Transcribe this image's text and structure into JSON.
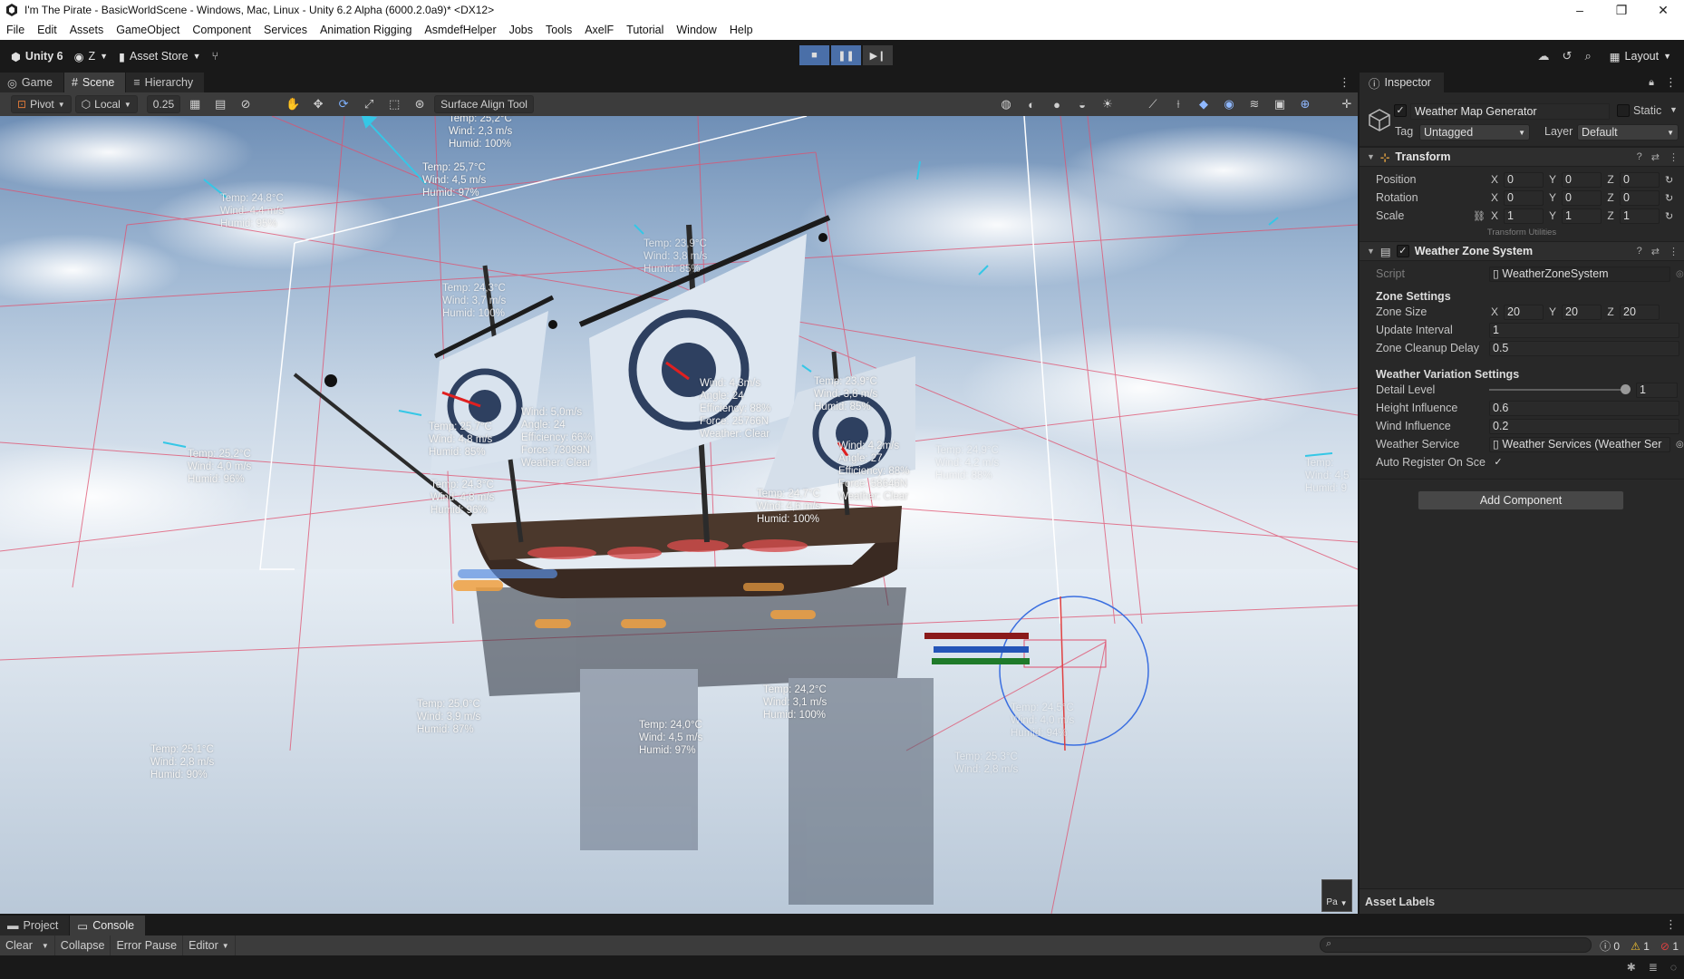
{
  "window": {
    "title": "I'm The Pirate - BasicWorldScene - Windows, Mac, Linux - Unity 6.2 Alpha (6000.2.0a9)* <DX12>",
    "controls": [
      "–",
      "❐",
      "✕"
    ]
  },
  "menu": [
    "File",
    "Edit",
    "Assets",
    "GameObject",
    "Component",
    "Services",
    "Animation Rigging",
    "AsmdefHelper",
    "Jobs",
    "Tools",
    "AxelF",
    "Tutorial",
    "Window",
    "Help"
  ],
  "toolbar": {
    "unity_label": "Unity 6",
    "account_label": "Z",
    "asset_store_label": "Asset Store",
    "layout_label": "Layout"
  },
  "tabs": [
    "Game",
    "Scene",
    "Hierarchy"
  ],
  "scene_toolbar": {
    "pivot_label": "Pivot",
    "local_label": "Local",
    "snap_value": "0.25",
    "surface_align_label": "Surface Align Tool"
  },
  "scene": {
    "weather_labels": [
      "Temp: 25,2°C\nWind: 2,3 m/s\nHumid: 100%",
      "Temp: 25,7°C\nWind: 4,5 m/s\nHumid: 97%",
      "Temp: 24,8°C\nWind: 4,4 m/s\nHumid: 95%",
      "Temp: 23,9°C\nWind: 3,8 m/s\nHumid: 85%",
      "Temp: 24,3°C\nWind: 3,7 m/s\nHumid: 100%",
      "Temp: 25,2°C\nWind: 4,0 m/s\nHumid: 96%",
      "Temp: 25,7°C\nWind: 4,8 m/s\nHumid: 85%",
      "Temp: 24,3°C\nWind: 4,8 m/s\nHumid: 96%",
      "Temp: 24,7°C\nWind: 4,6 m/s\nHumid: 100%",
      "Temp: 23,9°C\nWind: 3,8 m/s\nHumid: 85%",
      "Wind: 4,3m/s\nAngle: 24\nEfficiency: 88%\nForce: 25766N\nWeather: Clear",
      "Wind: 5,0m/s\nAngle: 24\nEfficiency: 66%\nForce: 73089N\nWeather: Clear",
      "Wind: 4,2m/s\nAngle: 27\nEfficiency: 88%\nForce: 58646N\nWeather: Clear",
      "Temp: 25,0°C\nWind: 3,9 m/s\nHumid: 87%",
      "Temp: 24,0°C\nWind: 4,5 m/s\nHumid: 97%",
      "Temp: 24,2°C\nWind: 3,1 m/s\nHumid: 100%",
      "Temp: 24,5°C\nWind: 4,0 m/s\nHumid: 94%",
      "Temp: 25,1°C\nWind: 2,8 m/s\nHumid: 90%",
      "Temp: 25,3°C\nWind: 2,8 m/s",
      "Temp: 24,9°C\nWind: 4,2 m/s\nHumid: 88%",
      "Temp:\nWind: 4,5\nHumid: 9"
    ],
    "gizmo_button_label": "Pa"
  },
  "inspector": {
    "tab_label": "Inspector",
    "object_name": "Weather Map Generator",
    "static_label": "Static",
    "tag_label": "Tag",
    "tag_value": "Untagged",
    "layer_label": "Layer",
    "layer_value": "Default",
    "transform": {
      "title": "Transform",
      "position_label": "Position",
      "rotation_label": "Rotation",
      "scale_label": "Scale",
      "position": [
        "0",
        "0",
        "0"
      ],
      "rotation": [
        "0",
        "0",
        "0"
      ],
      "scale": [
        "1",
        "1",
        "1"
      ],
      "utilities_label": "Transform Utilities"
    },
    "weather_zone": {
      "title": "Weather Zone System",
      "script_label": "Script",
      "script_value": "WeatherZoneSystem",
      "zone_settings_title": "Zone Settings",
      "zone_size_label": "Zone Size",
      "zone_size": [
        "20",
        "20",
        "20"
      ],
      "update_interval_label": "Update Interval",
      "update_interval": "1",
      "cleanup_delay_label": "Zone Cleanup Delay",
      "cleanup_delay": "0.5",
      "variation_title": "Weather Variation Settings",
      "detail_level_label": "Detail Level",
      "detail_level": "1",
      "height_influence_label": "Height Influence",
      "height_influence": "0.6",
      "wind_influence_label": "Wind Influence",
      "wind_influence": "0.2",
      "weather_service_label": "Weather Service",
      "weather_service_value": "Weather Services (Weather Ser",
      "auto_register_label": "Auto Register On Sce"
    },
    "add_component_label": "Add Component",
    "asset_labels_label": "Asset Labels"
  },
  "console": {
    "tabs": [
      "Project",
      "Console"
    ],
    "clear_label": "Clear",
    "collapse_label": "Collapse",
    "error_pause_label": "Error Pause",
    "editor_label": "Editor",
    "log_count": "0",
    "warning_count": "1",
    "error_count": "1"
  },
  "axes": [
    "X",
    "Y",
    "Z"
  ],
  "colors": {
    "accent": "#4a6fa8",
    "editor_bg": "#191919",
    "panel_bg": "#282828",
    "gizmo_red": "#e0506e",
    "gizmo_cyan": "#35c7e6"
  }
}
